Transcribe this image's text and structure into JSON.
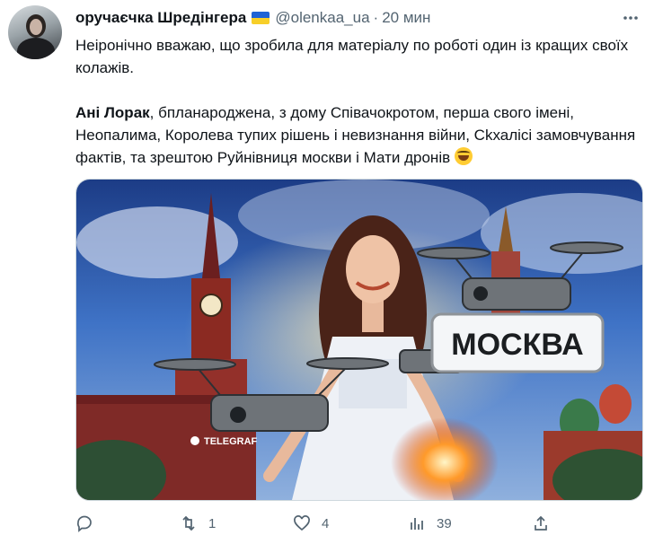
{
  "tweet": {
    "author_name": "оручаєчка Шредінгера",
    "handle": "@olenkaa_ua",
    "separator": "·",
    "time": "20 мин",
    "line1": "Неіронічно вважаю, що зробила для матеріалу по роботі один із кращих своїх колажів.",
    "bold_name": "Ані Лорак",
    "rest": ", бпланароджена, з дому Співачокротом, перша свого імені, Неопалима, Королева тупих рішень і невизнання війни, Ckхалісі замовчування фактів, та зрештою Руйнівниця москви і Мати дронів"
  },
  "image": {
    "sign_text": "МОСКВА",
    "watermark": "TELEGRAF"
  },
  "actions": {
    "replies": "",
    "retweets": "1",
    "likes": "4",
    "views": "39"
  },
  "icons": [
    "avatar",
    "ukraine-flag-icon",
    "more-icon",
    "rofl-emoji-icon",
    "reply-icon",
    "retweet-icon",
    "like-icon",
    "views-icon",
    "share-icon"
  ],
  "colors": {
    "text": "#0f1419",
    "muted": "#536471",
    "flag_blue": "#1f63d6",
    "flag_yellow": "#f7cf29"
  }
}
